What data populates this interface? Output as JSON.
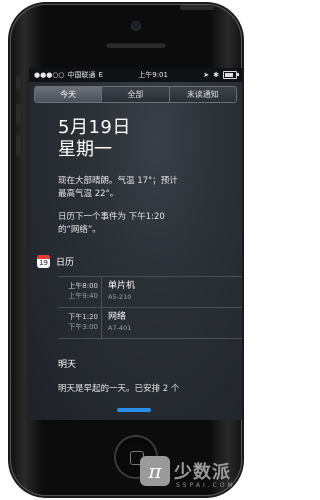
{
  "status_bar": {
    "carrier": "中国联通",
    "network": "E",
    "time": "上午9:01",
    "battery_level": 0.7
  },
  "tabs": [
    {
      "label": "今天",
      "active": true
    },
    {
      "label": "全部",
      "active": false
    },
    {
      "label": "未读通知",
      "active": false
    }
  ],
  "today": {
    "date": "5月19日",
    "weekday": "星期一",
    "weather_line1": "现在大部晴朗。气温 17°；预计",
    "weather_line2": "最高气温 22°。",
    "next_event_line1": "日历下一个事件为 下午1:20",
    "next_event_line2": "的“网络”。"
  },
  "calendar": {
    "title": "日历",
    "icon_day": "19",
    "events": [
      {
        "start": "上午8:00",
        "end": "上午9:40",
        "title": "单片机",
        "room": "A5-210"
      },
      {
        "start": "下午1:20",
        "end": "下午3:00",
        "title": "网络",
        "room": "A7-401"
      }
    ]
  },
  "tomorrow": {
    "title": "明天",
    "text": "明天是早起的一天。已安排 2 个"
  },
  "watermark": {
    "logo_glyph": "π",
    "name_cn": "少数派",
    "name_en": "SSPAI.COM"
  },
  "colors": {
    "accent_blue": "#2a8ee6",
    "calendar_red": "#e53b30"
  }
}
